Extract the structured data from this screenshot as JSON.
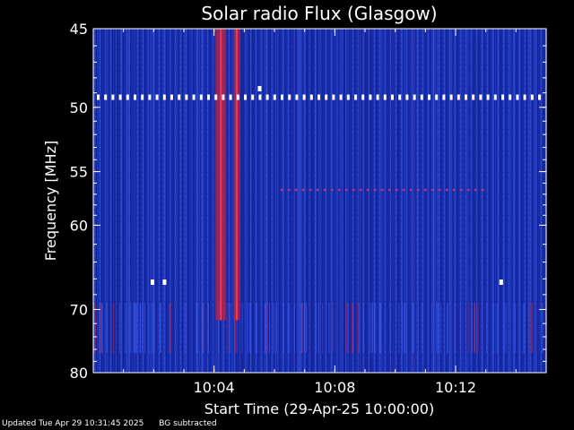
{
  "chart_data": {
    "type": "heatmap",
    "title": "Solar radio Flux (Glasgow)",
    "xlabel": "Start Time (29-Apr-25 10:00:00)",
    "ylabel": "Frequency [MHz]",
    "x_range_minutes": [
      0,
      15
    ],
    "x_ticks": [
      {
        "minute": 4,
        "label": "10:04"
      },
      {
        "minute": 8,
        "label": "10:08"
      },
      {
        "minute": 12,
        "label": "10:12"
      }
    ],
    "y_range_mhz": [
      45,
      80
    ],
    "y_ticks": [
      {
        "mhz": 45,
        "label": "45"
      },
      {
        "mhz": 50,
        "label": "50"
      },
      {
        "mhz": 55,
        "label": "55"
      },
      {
        "mhz": 60,
        "label": "60"
      },
      {
        "mhz": 70,
        "label": "70"
      },
      {
        "mhz": 80,
        "label": "80"
      }
    ],
    "y_scale": "reciprocal",
    "colors": {
      "background": "#1a2fb8",
      "burst": "#c0203a",
      "interference": "#ffffff"
    },
    "features": [
      {
        "kind": "burst",
        "minute_start": 4.05,
        "minute_end": 4.4,
        "mhz_start": 45,
        "mhz_end": 71.5
      },
      {
        "kind": "burst",
        "minute_start": 4.65,
        "minute_end": 4.85,
        "mhz_start": 45,
        "mhz_end": 71.5
      },
      {
        "kind": "interference_line",
        "mhz": 49.3,
        "minute_start": 0,
        "minute_end": 15
      },
      {
        "kind": "dotted_line",
        "mhz": 56.6,
        "minute_start": 6.2,
        "minute_end": 12.9
      }
    ]
  },
  "footer": {
    "updated": "Updated Tue Apr 29 10:31:45 2025",
    "note": "BG subtracted"
  }
}
